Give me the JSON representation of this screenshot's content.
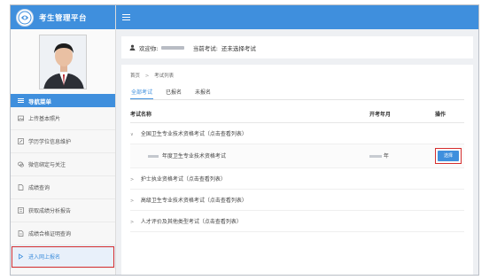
{
  "app": {
    "title": "考生管理平台"
  },
  "sidebar": {
    "nav_title": "导航菜单",
    "items": [
      {
        "label": "上传基本照片",
        "icon": "photo-icon"
      },
      {
        "label": "学历学位信息维护",
        "icon": "edit-icon"
      },
      {
        "label": "微信绑定与关注",
        "icon": "wechat-icon"
      },
      {
        "label": "成绩查询",
        "icon": "document-icon"
      },
      {
        "label": "获取成绩分析报告",
        "icon": "report-icon"
      },
      {
        "label": "成绩合格证明查询",
        "icon": "certificate-icon"
      },
      {
        "label": "进入网上报名",
        "icon": "enter-icon",
        "active": true
      }
    ]
  },
  "header": {
    "welcome_prefix": "欢迎你:",
    "current_exam_label": "当前考试:",
    "current_exam_value": "还未选择考试"
  },
  "breadcrumb": {
    "home": "首页",
    "separator": ">",
    "current": "考试列表"
  },
  "tabs": [
    {
      "label": "全部考试",
      "active": true
    },
    {
      "label": "已报名",
      "active": false
    },
    {
      "label": "未报名",
      "active": false
    }
  ],
  "table": {
    "headers": {
      "name": "考试名称",
      "date": "开考年月",
      "op": "操作"
    },
    "groups": [
      {
        "arrow": "∨",
        "label": "全国卫生专业技术资格考试（点击查看列表）"
      },
      {
        "arrow": ">",
        "label": "护士执业资格考试（点击查看列表）"
      },
      {
        "arrow": ">",
        "label": "高级卫生专业技术资格考试（点击查看列表）"
      },
      {
        "arrow": ">",
        "label": "人才评价及其他类型考试（点击查看列表）"
      }
    ],
    "sub_row": {
      "name": "年度卫生专业技术资格考试",
      "date_suffix": "年",
      "button": "选择"
    }
  },
  "colors": {
    "accent": "#3f8fdd",
    "highlight": "#d62f2f"
  }
}
